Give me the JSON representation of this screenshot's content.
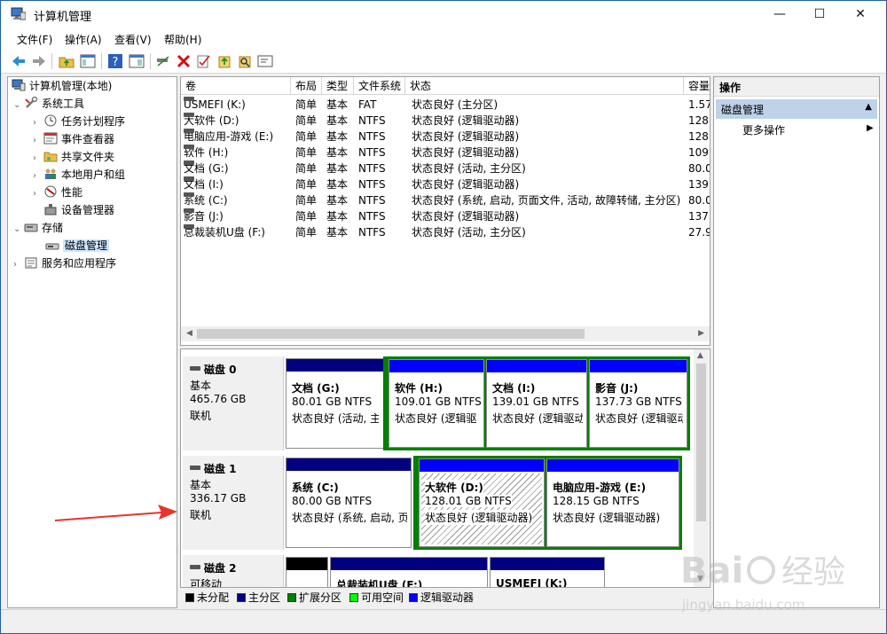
{
  "window": {
    "title": "计算机管理",
    "min": "—",
    "max": "☐",
    "close": "✕"
  },
  "menu": [
    "文件(F)",
    "操作(A)",
    "查看(V)",
    "帮助(H)"
  ],
  "tree": [
    {
      "label": "计算机管理(本地)",
      "icon": "computer-icon",
      "chev": ""
    },
    {
      "label": "系统工具",
      "icon": "tools-icon",
      "chev": "⌄"
    },
    {
      "label": "任务计划程序",
      "icon": "clock-icon",
      "chev": "›"
    },
    {
      "label": "事件查看器",
      "icon": "event-viewer-icon",
      "chev": "›"
    },
    {
      "label": "共享文件夹",
      "icon": "shared-folder-icon",
      "chev": "›"
    },
    {
      "label": "本地用户和组",
      "icon": "users-icon",
      "chev": "›"
    },
    {
      "label": "性能",
      "icon": "performance-icon",
      "chev": "›"
    },
    {
      "label": "设备管理器",
      "icon": "device-manager-icon",
      "chev": ""
    },
    {
      "label": "存储",
      "icon": "storage-icon",
      "chev": "⌄"
    },
    {
      "label": "磁盘管理",
      "icon": "disk-icon",
      "chev": ""
    },
    {
      "label": "服务和应用程序",
      "icon": "services-icon",
      "chev": "›"
    }
  ],
  "volume_table": {
    "headers": [
      "卷",
      "布局",
      "类型",
      "文件系统",
      "状态",
      "容量"
    ],
    "rows": [
      {
        "vol": "USMEFI (K:)",
        "layout": "简单",
        "type": "基本",
        "fs": "FAT",
        "status": "状态良好 (主分区)",
        "cap": "1.57"
      },
      {
        "vol": "大软件 (D:)",
        "layout": "简单",
        "type": "基本",
        "fs": "NTFS",
        "status": "状态良好 (逻辑驱动器)",
        "cap": "128"
      },
      {
        "vol": "电脑应用-游戏 (E:)",
        "layout": "简单",
        "type": "基本",
        "fs": "NTFS",
        "status": "状态良好 (逻辑驱动器)",
        "cap": "128"
      },
      {
        "vol": "软件 (H:)",
        "layout": "简单",
        "type": "基本",
        "fs": "NTFS",
        "status": "状态良好 (逻辑驱动器)",
        "cap": "109"
      },
      {
        "vol": "文档 (G:)",
        "layout": "简单",
        "type": "基本",
        "fs": "NTFS",
        "status": "状态良好 (活动, 主分区)",
        "cap": "80.0"
      },
      {
        "vol": "文档 (I:)",
        "layout": "简单",
        "type": "基本",
        "fs": "NTFS",
        "status": "状态良好 (逻辑驱动器)",
        "cap": "139"
      },
      {
        "vol": "系统 (C:)",
        "layout": "简单",
        "type": "基本",
        "fs": "NTFS",
        "status": "状态良好 (系统, 启动, 页面文件, 活动, 故障转储, 主分区)",
        "cap": "80.0"
      },
      {
        "vol": "影音 (J:)",
        "layout": "简单",
        "type": "基本",
        "fs": "NTFS",
        "status": "状态良好 (逻辑驱动器)",
        "cap": "137"
      },
      {
        "vol": "总裁装机U盘 (F:)",
        "layout": "简单",
        "type": "基本",
        "fs": "NTFS",
        "status": "状态良好 (活动, 主分区)",
        "cap": "27.9"
      }
    ]
  },
  "disks": [
    {
      "name": "磁盘 0",
      "kind": "基本",
      "size": "465.76 GB",
      "state": "联机",
      "parts": [
        {
          "name": "文档  (G:)",
          "size": "80.01 GB NTFS",
          "status": "状态良好 (活动, 主"
        },
        {
          "name": "软件  (H:)",
          "size": "109.01 GB NTFS",
          "status": "状态良好 (逻辑驱"
        },
        {
          "name": "文档  (I:)",
          "size": "139.01 GB NTFS",
          "status": "状态良好 (逻辑驱动"
        },
        {
          "name": "影音  (J:)",
          "size": "137.73 GB NTFS",
          "status": "状态良好 (逻辑驱动"
        }
      ]
    },
    {
      "name": "磁盘 1",
      "kind": "基本",
      "size": "336.17 GB",
      "state": "联机",
      "parts": [
        {
          "name": "系统  (C:)",
          "size": "80.00 GB NTFS",
          "status": "状态良好 (系统, 启动, 页"
        },
        {
          "name": "大软件  (D:)",
          "size": "128.01 GB NTFS",
          "status": "状态良好 (逻辑驱动器)"
        },
        {
          "name": "电脑应用-游戏  (E:)",
          "size": "128.15 GB NTFS",
          "status": "状态良好 (逻辑驱动器)"
        }
      ]
    },
    {
      "name": "磁盘 2",
      "kind": "可移动",
      "size": "",
      "state": "",
      "parts": [
        {
          "name": "总裁装机U盘  (F:)",
          "size": "",
          "status": ""
        },
        {
          "name": "USMEFI  (K:)",
          "size": "",
          "status": ""
        }
      ]
    }
  ],
  "legend": [
    {
      "label": "未分配",
      "color": "#000000"
    },
    {
      "label": "主分区",
      "color": "#000080"
    },
    {
      "label": "扩展分区",
      "color": "#008000"
    },
    {
      "label": "可用空间",
      "color": "#00ff00"
    },
    {
      "label": "逻辑驱动器",
      "color": "#0000ff"
    }
  ],
  "actions": {
    "header": "操作",
    "selected": "磁盘管理",
    "more": "更多操作"
  },
  "colors": {
    "primary": "#000080",
    "logical": "#0000ff",
    "extended": "#008000",
    "unallocated": "#000000",
    "selection": "#cce8ff"
  },
  "watermark": {
    "brand": "Bai",
    "brand2": "经验",
    "url": "jingyan.baidu.com"
  }
}
